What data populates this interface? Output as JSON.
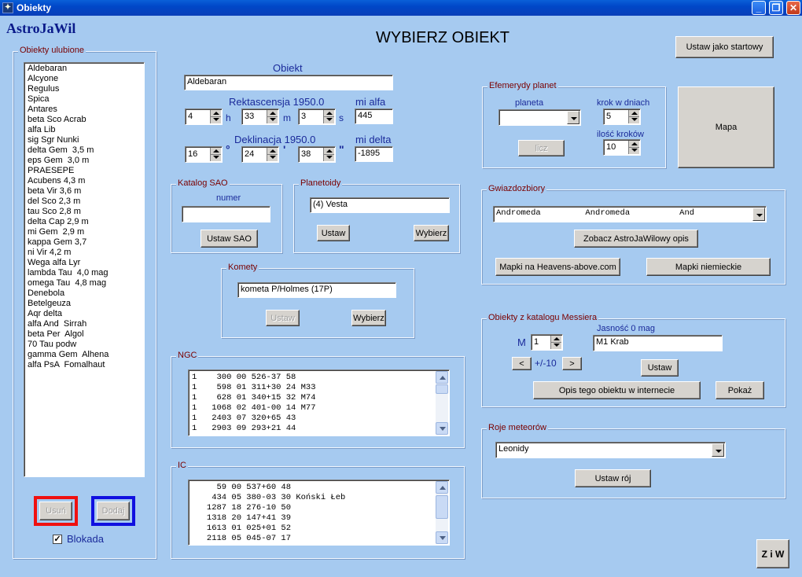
{
  "window": {
    "title": "Obiekty",
    "app_icon": "star-icon",
    "min_label": "_",
    "max_label": "❐",
    "close_label": "✕"
  },
  "brand": "AstroJaWil",
  "heading": "WYBIERZ OBIEKT",
  "set_start_button": "Ustaw jako startowy",
  "favorites": {
    "title": "Obiekty ulubione",
    "items": [
      "Aldebaran",
      "Alcyone",
      "Regulus",
      "Spica",
      "Antares",
      "beta Sco Acrab",
      "alfa Lib",
      "sig Sgr Nunki",
      "delta Gem  3,5 m",
      "eps Gem  3,0 m",
      "PRAESEPE",
      "Acubens 4,3 m",
      "beta Vir 3,6 m",
      "del Sco 2,3 m",
      "tau Sco 2,8 m",
      "delta Cap 2,9 m",
      "mi Gem  2,9 m",
      "kappa Gem 3,7",
      "ni Vir 4,2 m",
      "Wega alfa Lyr",
      "lambda Tau  4,0 mag",
      "omega Tau  4,8 mag",
      "Denebola",
      "Betelgeuza",
      "Aqr delta",
      "alfa And  Sirrah",
      "beta Per  Algol",
      "70 Tau podw",
      "gamma Gem  Alhena",
      "alfa PsA  Fomalhaut"
    ],
    "remove_button": "Usuń",
    "add_button": "Dodaj",
    "lock_label": "Blokada",
    "lock_checked": true
  },
  "object": {
    "title": "Obiekt",
    "name": "Aldebaran",
    "ra_title": "Rektascensja  1950.0",
    "ra_h": "4",
    "ra_h_unit": "h",
    "ra_m": "33",
    "ra_m_unit": "m",
    "ra_s": "3",
    "ra_s_unit": "s",
    "mi_alfa_label": "mi alfa",
    "mi_alfa": "445",
    "dec_title": "Deklinacja  1950.0",
    "dec_d": "16",
    "dec_d_unit": "°",
    "dec_m": "24",
    "dec_m_unit": "'",
    "dec_s": "38",
    "dec_s_unit": "\"",
    "mi_delta_label": "mi delta",
    "mi_delta": "-1895"
  },
  "sao": {
    "title": "Katalog SAO",
    "number_label": "numer",
    "number_value": "",
    "button": "Ustaw SAO"
  },
  "planetoids": {
    "title": "Planetoidy",
    "value": "(4) Vesta",
    "set_button": "Ustaw",
    "choose_button": "Wybierz"
  },
  "comets": {
    "title": "Komety",
    "value": "kometa P/Holmes (17P)",
    "set_button": "Ustaw",
    "choose_button": "Wybierz"
  },
  "ngc": {
    "title": "NGC",
    "rows": [
      "1    300 00 526-37 58",
      "1    598 01 311+30 24 M33",
      "1    628 01 340+15 32 M74",
      "1   1068 02 401-00 14 M77",
      "1   2403 07 320+65 43",
      "1   2903 09 293+21 44"
    ]
  },
  "ic": {
    "title": "IC",
    "rows": [
      "     59 00 537+60 48",
      "    434 05 380-03 30 Koński Łeb",
      "   1287 18 276-10 50",
      "   1318 20 147+41 39",
      "   1613 01 025+01 52",
      "   2118 05 045-07 17"
    ]
  },
  "ephemeris": {
    "title": "Efemerydy planet",
    "planet_label": "planeta",
    "planet_value": "",
    "step_label": "krok w dniach",
    "step_value": "5",
    "count_label": "ilość kroków",
    "count_value": "10",
    "compute_button": "licz"
  },
  "map_button": "Mapa",
  "constellations": {
    "title": "Gwiazdozbiory",
    "selected": "Andromeda         Andromeda          And",
    "describe_button": "Zobacz AstroJaWilowy opis",
    "heavens_button": "Mapki na Heavens-above.com",
    "german_button": "Mapki niemieckie"
  },
  "messier": {
    "title": "Obiekty z katalogu Messiera",
    "brightness_label": "Jasność  0 mag",
    "m_label": "M",
    "m_value": "1",
    "name": "M1 Krab",
    "prev_button": "<",
    "step_label": "+/-10",
    "next_button": ">",
    "set_button": "Ustaw",
    "web_button": "Opis tego obiektu w internecie",
    "show_button": "Pokaż"
  },
  "meteors": {
    "title": "Roje meteorów",
    "selected": "Leonidy",
    "button": "Ustaw rój"
  },
  "ziw_button": "Z i W"
}
